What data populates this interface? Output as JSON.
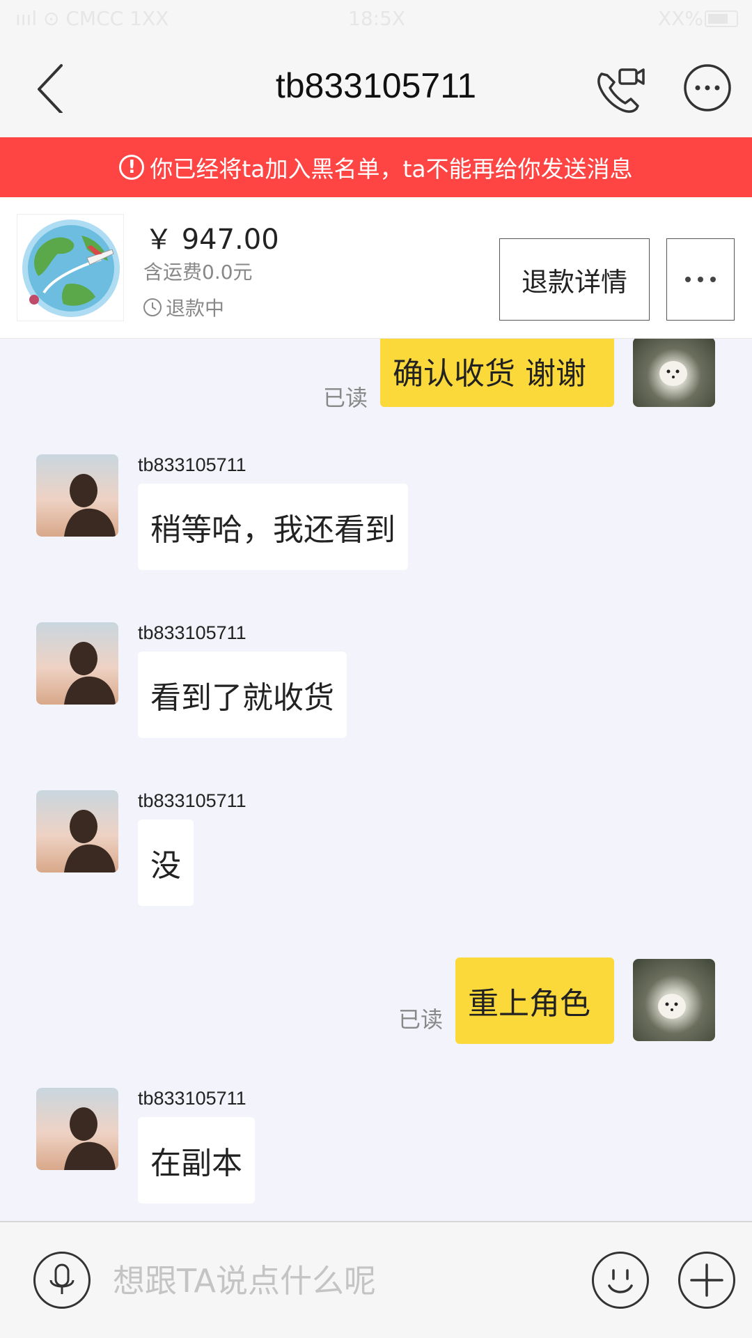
{
  "status_bar": {
    "carrier": "ıııl ⊙ CMCC 1XX",
    "time": "18:5X",
    "battery": "XX%"
  },
  "header": {
    "title": "tb833105711"
  },
  "banner": {
    "icon": "!",
    "text": "你已经将ta加入黑名单，ta不能再给你发送消息"
  },
  "order": {
    "price": "￥ 947.00",
    "shipping": "含运费0.0元",
    "status": "退款中",
    "refund_button": "退款详情"
  },
  "messages": [
    {
      "side": "out",
      "text": "确认收货 谢谢",
      "read": "已读"
    },
    {
      "side": "in",
      "sender": "tb833105711",
      "text": "稍等哈，我还看到"
    },
    {
      "side": "in",
      "sender": "tb833105711",
      "text": "看到了就收货"
    },
    {
      "side": "in",
      "sender": "tb833105711",
      "text": "没"
    },
    {
      "side": "out",
      "text": "重上角色",
      "read": "已读"
    },
    {
      "side": "in",
      "sender": "tb833105711",
      "text": "在副本"
    }
  ],
  "input": {
    "placeholder": "想跟TA说点什么呢"
  },
  "colors": {
    "banner": "#ff4444",
    "outgoing_bubble": "#fcd93a",
    "incoming_bubble": "#ffffff",
    "chat_bg": "#f3f4fb"
  }
}
